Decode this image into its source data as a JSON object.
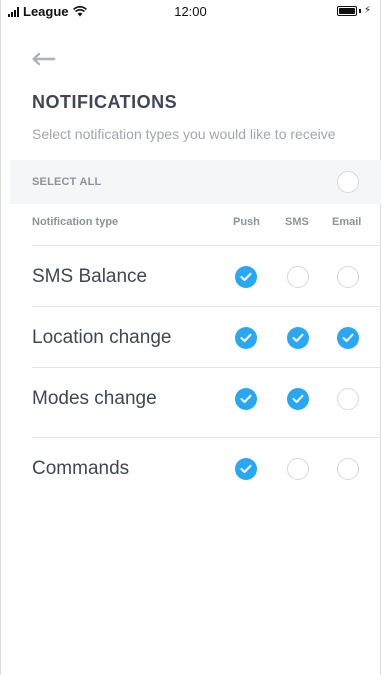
{
  "status_bar": {
    "carrier": "League",
    "time": "12:00"
  },
  "header": {
    "title": "NOTIFICATIONS",
    "subtitle": "Select notification types you would like to receive"
  },
  "select_all": {
    "label": "SELECT ALL",
    "checked": false
  },
  "table": {
    "columns": {
      "type": "Notification type",
      "push": "Push",
      "sms": "SMS",
      "email": "Email"
    },
    "rows": [
      {
        "name": "SMS Balance",
        "push": true,
        "sms": false,
        "email": false
      },
      {
        "name": "Location change",
        "push": true,
        "sms": true,
        "email": true
      },
      {
        "name": "Modes change",
        "push": true,
        "sms": true,
        "email": false
      },
      {
        "name": "Commands",
        "push": true,
        "sms": false,
        "email": false
      }
    ]
  },
  "colors": {
    "accent": "#2aa7f2",
    "title": "#414656",
    "muted": "#a2a6b0",
    "band": "#f5f6f8"
  }
}
